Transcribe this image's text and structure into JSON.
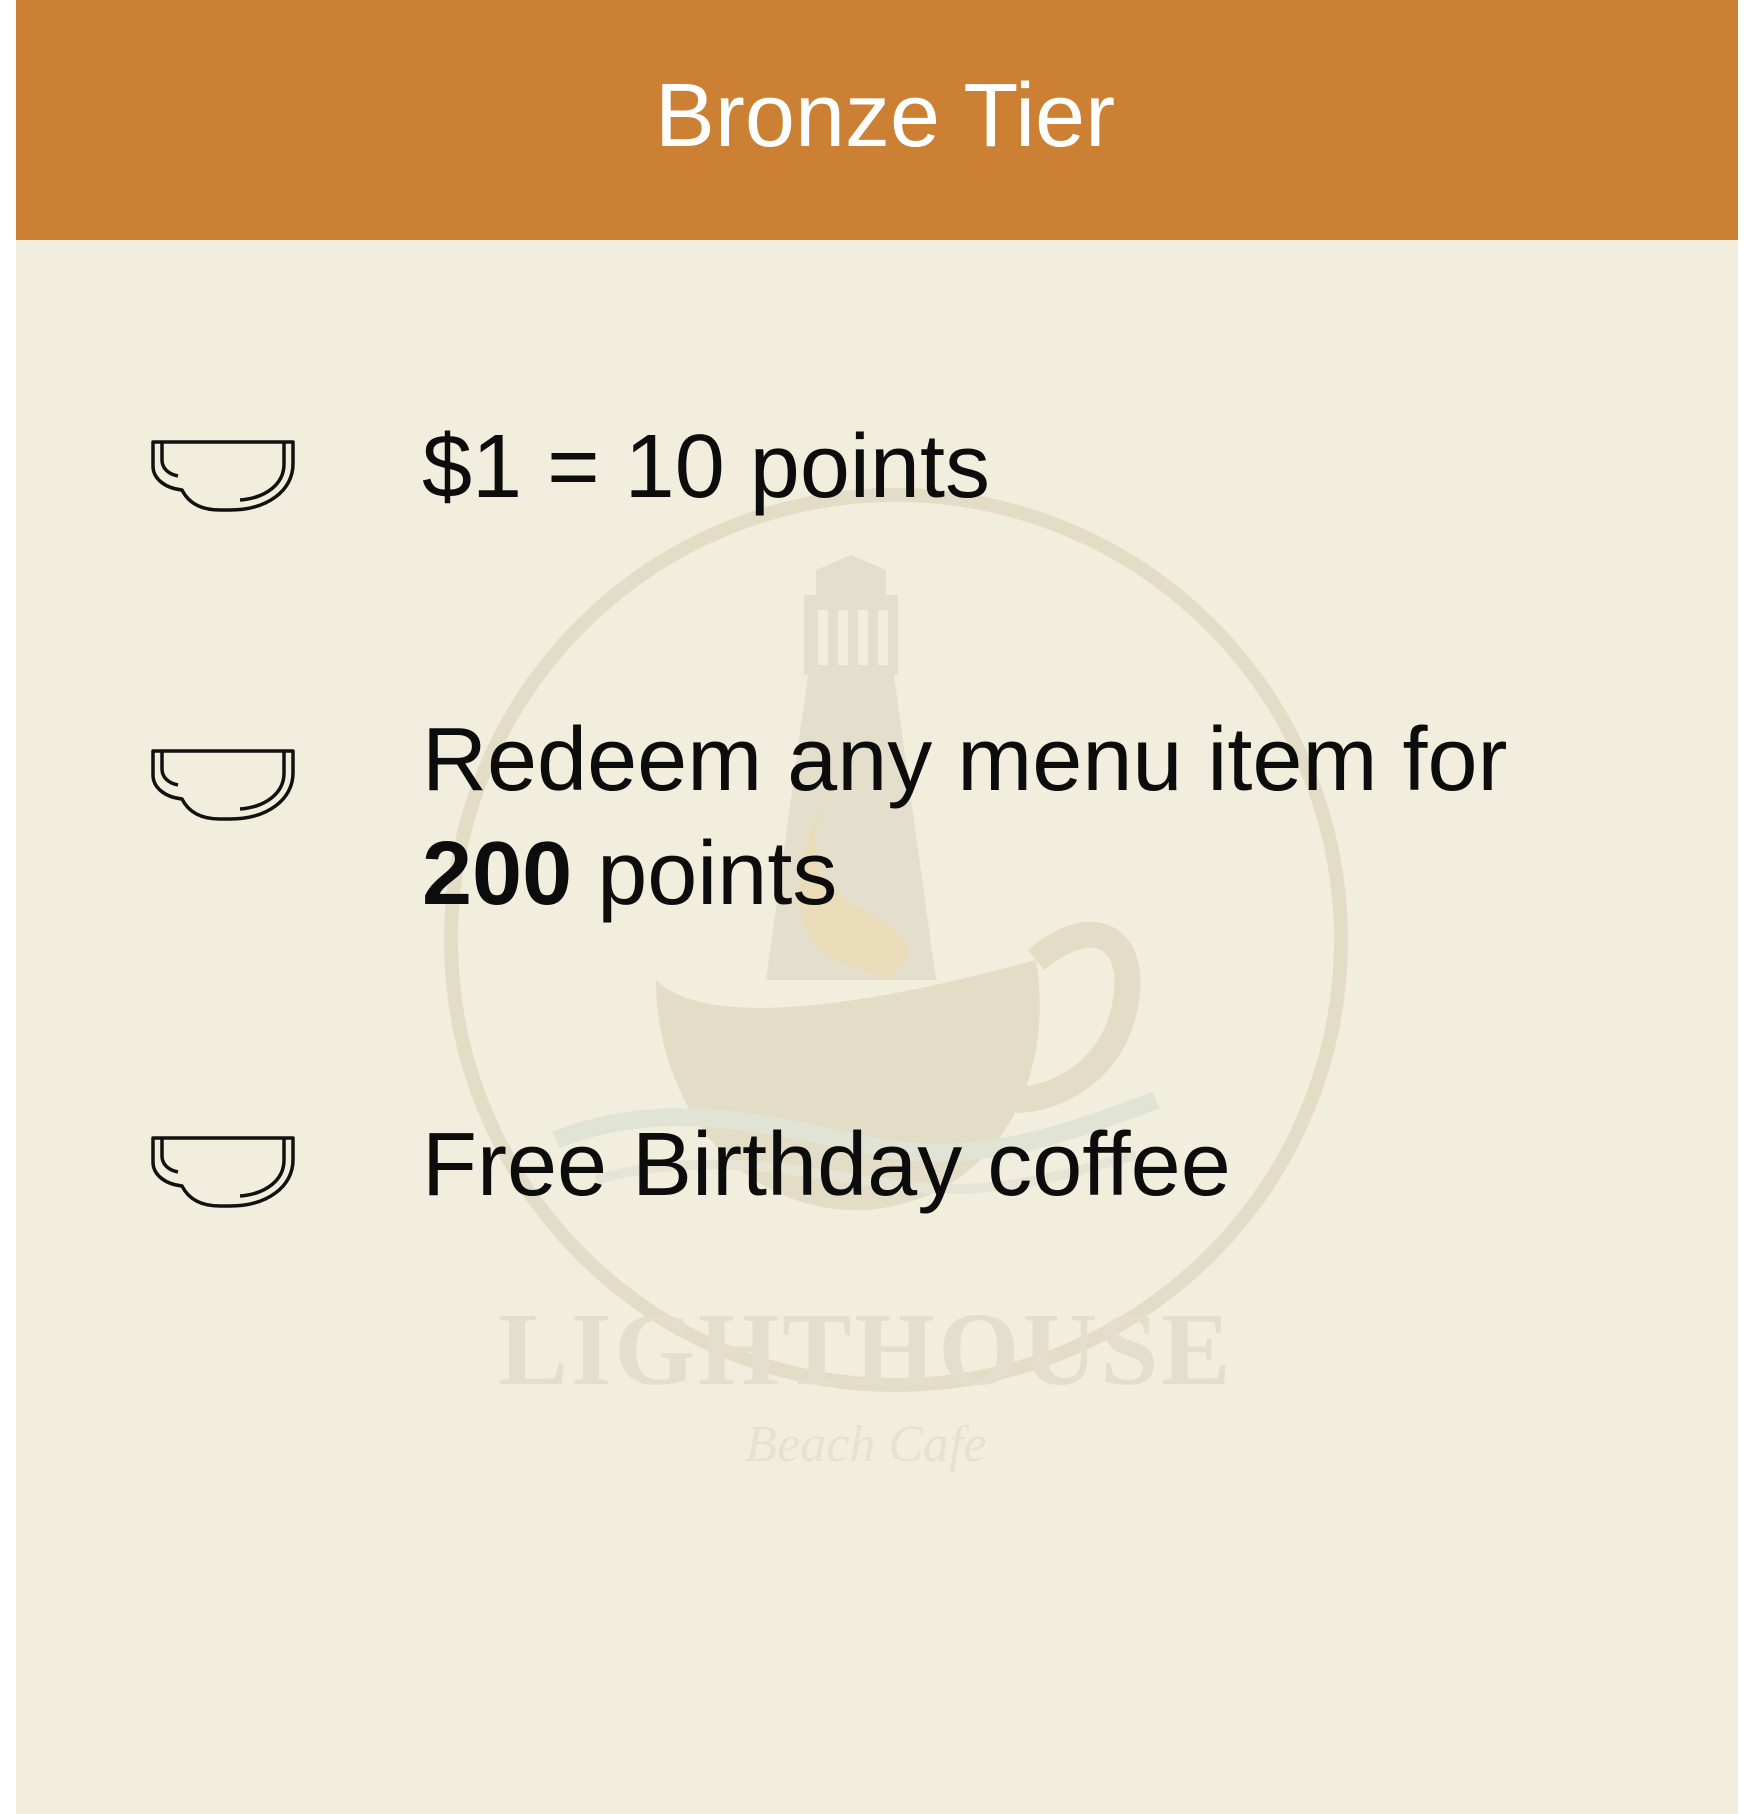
{
  "header": {
    "title": "Bronze Tier"
  },
  "colors": {
    "header_background": "#cc8033",
    "card_background": "#f1eedd",
    "text": "#0c0c0c",
    "header_text": "#ffffff"
  },
  "watermark": {
    "logo_name": "lighthouse-cafe-logo",
    "brand": "LIGHTHOUSE",
    "tagline": "Beach Cafe"
  },
  "benefits": [
    {
      "icon": "coffee-cup-icon",
      "text": "$1 = 10 points"
    },
    {
      "icon": "coffee-cup-icon",
      "text_before_bold": "Redeem any menu item for",
      "bold": "200",
      "text_after_bold": "points"
    },
    {
      "icon": "coffee-cup-icon",
      "text": "Free Birthday coffee"
    }
  ]
}
